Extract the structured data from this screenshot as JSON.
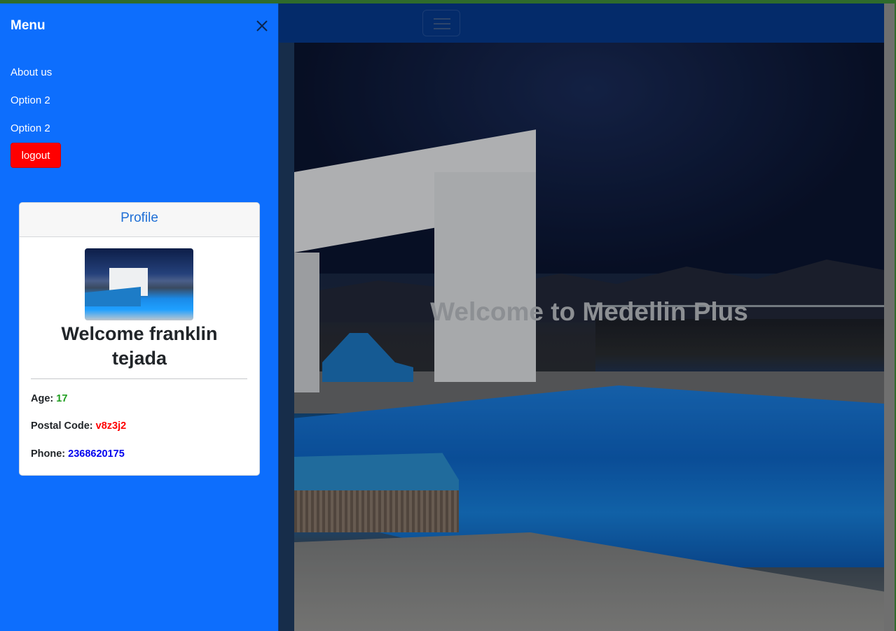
{
  "offcanvas": {
    "title": "Menu",
    "links": [
      "About us",
      "Option 2",
      "Option 2"
    ],
    "logout_label": "logout"
  },
  "profile": {
    "header": "Profile",
    "welcome": "Welcome franklin tejada",
    "age_label": "Age:",
    "age_value": "17",
    "postal_label": "Postal Code:",
    "postal_value": "v8z3j2",
    "phone_label": "Phone:",
    "phone_value": "2368620175"
  },
  "hero": {
    "title": "Welcome to Medellin Plus"
  },
  "colors": {
    "offcanvas_bg": "#0d6efd",
    "navbar_bg": "#063a8e",
    "logout_bg": "#ff0000",
    "age_value": "#1e9e1e",
    "postal_value": "#ff0000",
    "phone_value": "#0000ee"
  },
  "icons": {
    "close": "close-icon",
    "navbar_toggler": "hamburger-icon"
  }
}
